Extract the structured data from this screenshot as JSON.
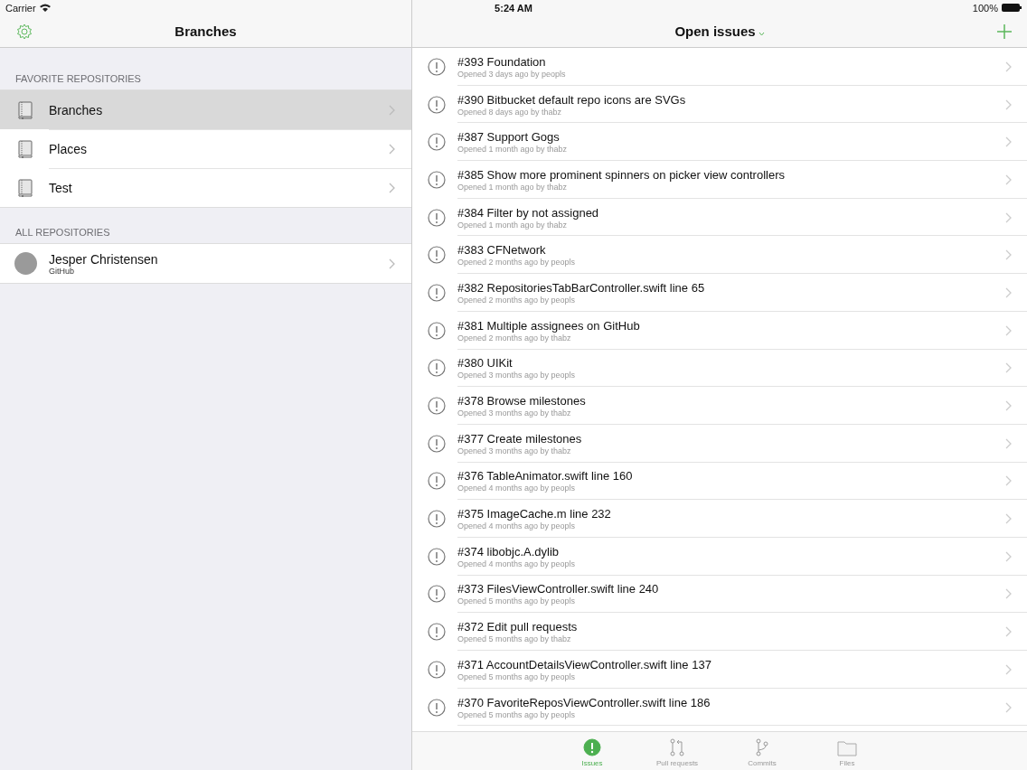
{
  "status_bar": {
    "carrier": "Carrier",
    "time": "5:24 AM",
    "battery": "100%"
  },
  "sidebar": {
    "title": "Branches",
    "sections": [
      {
        "header": "FAVORITE REPOSITORIES",
        "items": [
          {
            "kind": "repo",
            "name": "Branches",
            "selected": true
          },
          {
            "kind": "repo",
            "name": "Places",
            "selected": false
          },
          {
            "kind": "repo",
            "name": "Test",
            "selected": false
          }
        ]
      },
      {
        "header": "ALL REPOSITORIES",
        "items": [
          {
            "kind": "account",
            "name": "Jesper Christensen",
            "subtitle": "GitHub",
            "selected": false
          }
        ]
      }
    ]
  },
  "issues": {
    "title": "Open issues",
    "rows": [
      {
        "title": "#393 Foundation",
        "meta": "Opened 3 days ago by peopls"
      },
      {
        "title": "#390 Bitbucket default repo icons are SVGs",
        "meta": "Opened 8 days ago by thabz"
      },
      {
        "title": "#387 Support Gogs",
        "meta": "Opened 1 month ago by thabz"
      },
      {
        "title": "#385 Show more prominent spinners on picker view controllers",
        "meta": "Opened 1 month ago by thabz"
      },
      {
        "title": "#384 Filter by not assigned",
        "meta": "Opened 1 month ago by thabz"
      },
      {
        "title": "#383 CFNetwork",
        "meta": "Opened 2 months ago by peopls"
      },
      {
        "title": "#382 RepositoriesTabBarController.swift line 65",
        "meta": "Opened 2 months ago by peopls"
      },
      {
        "title": "#381 Multiple assignees on GitHub",
        "meta": "Opened 2 months ago by thabz"
      },
      {
        "title": "#380 UIKit",
        "meta": "Opened 3 months ago by peopls"
      },
      {
        "title": "#378 Browse milestones",
        "meta": "Opened 3 months ago by thabz"
      },
      {
        "title": "#377 Create milestones",
        "meta": "Opened 3 months ago by thabz"
      },
      {
        "title": "#376 TableAnimator.swift line 160",
        "meta": "Opened 4 months ago by peopls"
      },
      {
        "title": "#375 ImageCache.m line 232",
        "meta": "Opened 4 months ago by peopls"
      },
      {
        "title": "#374 libobjc.A.dylib",
        "meta": "Opened 4 months ago by peopls"
      },
      {
        "title": "#373 FilesViewController.swift line 240",
        "meta": "Opened 5 months ago by peopls"
      },
      {
        "title": "#372 Edit pull requests",
        "meta": "Opened 5 months ago by thabz"
      },
      {
        "title": "#371 AccountDetailsViewController.swift line 137",
        "meta": "Opened 5 months ago by peopls"
      },
      {
        "title": "#370 FavoriteReposViewController.swift line 186",
        "meta": "Opened 5 months ago by peopls"
      }
    ]
  },
  "tab_bar": [
    {
      "kind": "issues",
      "label": "Issues",
      "selected": true
    },
    {
      "kind": "pulls",
      "label": "Pull requests",
      "selected": false
    },
    {
      "kind": "commits",
      "label": "Commits",
      "selected": false
    },
    {
      "kind": "files",
      "label": "Files",
      "selected": false
    }
  ]
}
